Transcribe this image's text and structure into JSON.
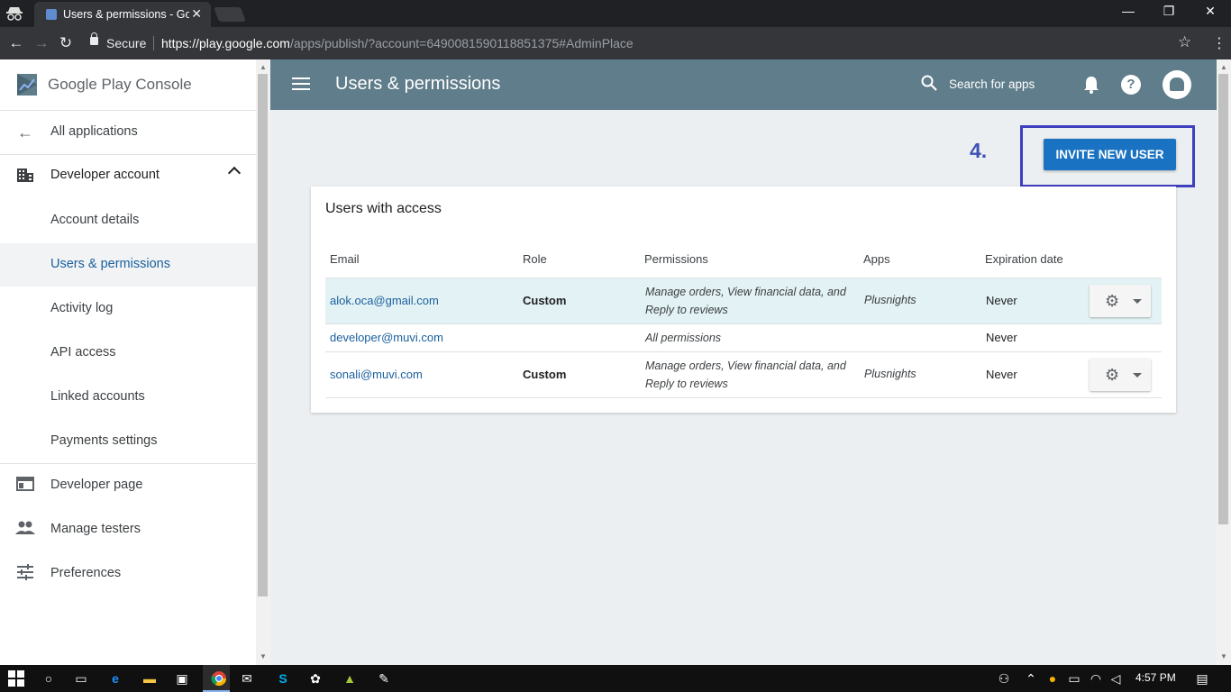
{
  "browser": {
    "tab_title": "Users & permissions - Google Play Console",
    "secure_label": "Secure",
    "url_domain": "https://play.google.com",
    "url_path": "/apps/publish/?account=6490081590118851375#AdminPlace"
  },
  "sidebar": {
    "brand_google_play": "Google Play",
    "brand_console": "Console",
    "back_label": "All applications",
    "section_label": "Developer account",
    "items": [
      {
        "label": "Account details"
      },
      {
        "label": "Users & permissions"
      },
      {
        "label": "Activity log"
      },
      {
        "label": "API access"
      },
      {
        "label": "Linked accounts"
      },
      {
        "label": "Payments settings"
      }
    ],
    "bottom_items": [
      {
        "label": "Developer page",
        "icon": "web-page-icon"
      },
      {
        "label": "Manage testers",
        "icon": "people-icon"
      },
      {
        "label": "Preferences",
        "icon": "sliders-icon"
      }
    ]
  },
  "header": {
    "title": "Users & permissions",
    "search_label": "Search for apps"
  },
  "annotation": {
    "step": "4."
  },
  "actions": {
    "invite_label": "INVITE NEW USER"
  },
  "users_card": {
    "title": "Users with access",
    "columns": [
      "Email",
      "Role",
      "Permissions",
      "Apps",
      "Expiration date"
    ],
    "rows": [
      {
        "email": "alok.oca@gmail.com",
        "role": "Custom",
        "permissions_line1": "Manage orders, View financial data, and",
        "permissions_line2": "Reply to reviews",
        "apps": "Plusnights",
        "expiration": "Never"
      },
      {
        "email": "developer@muvi.com",
        "role": "",
        "permissions_line1": "All permissions",
        "permissions_line2": "",
        "apps": "",
        "expiration": "Never"
      },
      {
        "email": "sonali@muvi.com",
        "role": "Custom",
        "permissions_line1": "Manage orders, View financial data, and",
        "permissions_line2": "Reply to reviews",
        "apps": "Plusnights",
        "expiration": "Never"
      }
    ]
  },
  "taskbar": {
    "time": "4:57 PM"
  },
  "colors": {
    "header_bg": "#607d8b",
    "accent_button": "#1a73c2",
    "annotation": "#3f3fbf",
    "selected_row": "#e3f2f4"
  }
}
